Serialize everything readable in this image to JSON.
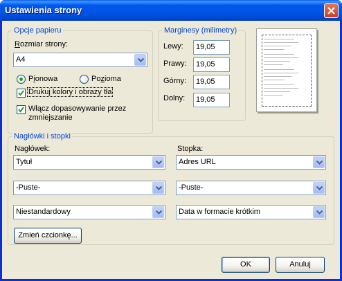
{
  "window": {
    "title": "Ustawienia strony"
  },
  "paper": {
    "legend": "Opcje papieru",
    "size_label": "Rozmiar strony:",
    "size_value": "A4",
    "portrait_label": "Pionowa",
    "landscape_label": "Pozioma",
    "orientation_selected": "portrait",
    "print_colors_label": "Drukuj kolory i obrazy tła",
    "print_colors_checked": true,
    "shrink_label_line1": "Włącz dopasowywanie przez",
    "shrink_label_line2": "zmniejszanie",
    "shrink_checked": true
  },
  "margins": {
    "legend": "Marginesy (milimetry)",
    "left_label": "Lewy:",
    "left_value": "19,05",
    "right_label": "Prawy:",
    "right_value": "19,05",
    "top_label": "Górny:",
    "top_value": "19,05",
    "bottom_label": "Dolny:",
    "bottom_value": "19,05"
  },
  "headers_footers": {
    "legend": "Nagłówki i stopki",
    "header_label": "Nagłówek:",
    "footer_label": "Stopka:",
    "header_1": "Tytuł",
    "header_2": "-Puste-",
    "header_3": "Niestandardowy",
    "footer_1": "Adres URL",
    "footer_2": "-Puste-",
    "footer_3": "Data w formacie krótkim",
    "change_font_label": "Zmień czcionkę..."
  },
  "buttons": {
    "ok": "OK",
    "cancel": "Anuluj"
  },
  "icons": {
    "close": "close-icon",
    "dropdown": "chevron-down-icon",
    "check": "check-icon",
    "preview": "page-preview-icon"
  }
}
